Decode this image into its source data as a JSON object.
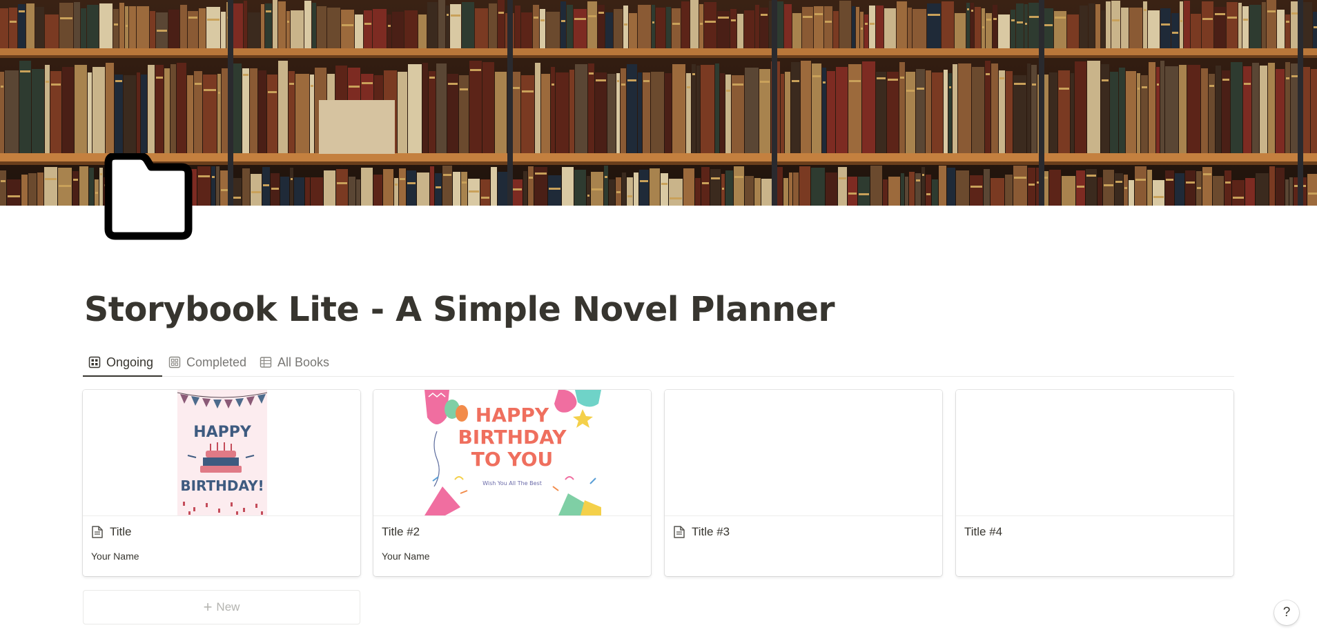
{
  "page": {
    "title": "Storybook Lite - A Simple Novel Planner",
    "icon": "folder-icon",
    "cover_image": "bookshelf-photo"
  },
  "tabs": [
    {
      "label": "Ongoing",
      "icon": "gallery-view-icon",
      "active": true
    },
    {
      "label": "Completed",
      "icon": "gallery-view-icon",
      "active": false
    },
    {
      "label": "All Books",
      "icon": "table-view-icon",
      "active": false
    }
  ],
  "cards": [
    {
      "title": "Title",
      "author": "Your Name",
      "has_doc_icon": true,
      "cover": "happy-birthday-cake-card"
    },
    {
      "title": "Title #2",
      "author": "Your Name",
      "has_doc_icon": false,
      "cover": "happy-birthday-to-you-card"
    },
    {
      "title": "Title #3",
      "author": "",
      "has_doc_icon": true,
      "cover": ""
    },
    {
      "title": "Title #4",
      "author": "",
      "has_doc_icon": false,
      "cover": ""
    }
  ],
  "cover_text": {
    "card1_line1": "HAPPY",
    "card1_line2": "BIRTHDAY!",
    "card2_line1": "HAPPY",
    "card2_line2": "BIRTHDAY",
    "card2_line3": "TO YOU",
    "card2_line4": "Wish You All The Best"
  },
  "new_button": {
    "label": "New"
  },
  "help_button": {
    "label": "?"
  },
  "colors": {
    "text": "#37352f",
    "muted": "#787774",
    "border": "#e9e9e7",
    "birthday_coral": "#ef6f5e"
  }
}
